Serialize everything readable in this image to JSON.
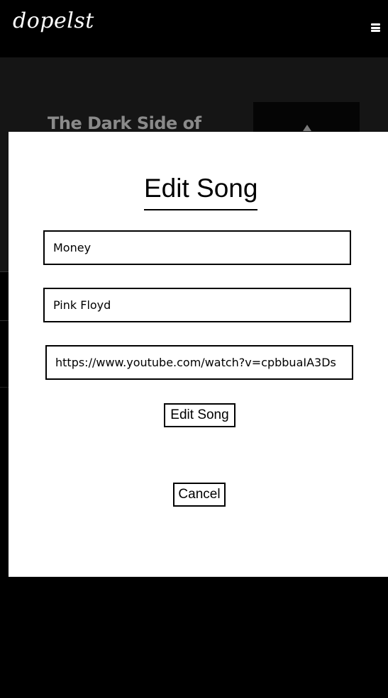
{
  "header": {
    "logo_text": "dopelst",
    "menu_icon": "hamburger-menu-icon"
  },
  "background": {
    "album_title": "The Dark Side of"
  },
  "modal": {
    "title": "Edit Song",
    "fields": {
      "song_title": "Money",
      "artist": "Pink Floyd",
      "url": "https://www.youtube.com/watch?v=cpbbuaIA3Ds"
    },
    "submit_label": "Edit Song",
    "cancel_label": "Cancel"
  },
  "colors": {
    "background": "#000000",
    "modal": "#ffffff",
    "hero": "#151515",
    "hero_title": "#8a8a8a"
  }
}
